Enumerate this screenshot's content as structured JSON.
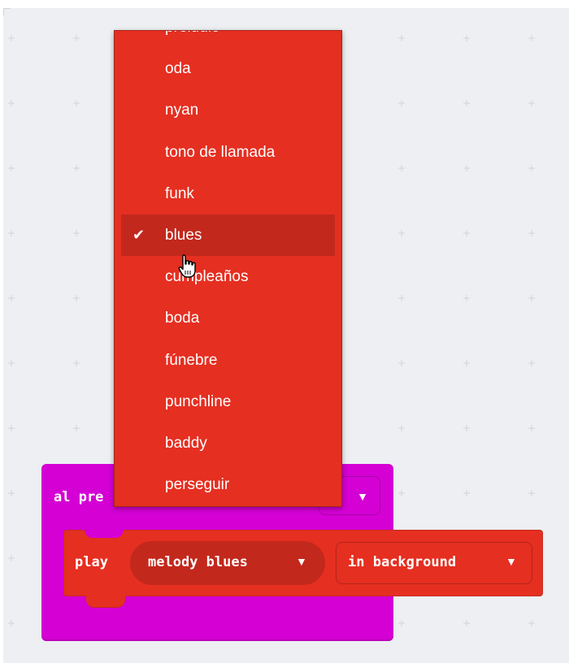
{
  "event_block": {
    "label": "al pre",
    "color": "#d400d4",
    "dropdown_arrow": "▼"
  },
  "play_block": {
    "play_label": "play",
    "melody_label": "melody blues",
    "melody_arrow": "▼",
    "background_label": "in background",
    "background_arrow": "▼",
    "color": "#e52f21"
  },
  "menu": {
    "items": [
      {
        "label": "preludio"
      },
      {
        "label": "oda"
      },
      {
        "label": "nyan"
      },
      {
        "label": "tono de llamada"
      },
      {
        "label": "funk"
      },
      {
        "label": "blues",
        "selected": true
      },
      {
        "label": "cumpleaños"
      },
      {
        "label": "boda"
      },
      {
        "label": "fúnebre"
      },
      {
        "label": "punchline"
      },
      {
        "label": "baddy"
      },
      {
        "label": "perseguir"
      }
    ],
    "check_icon": "check-icon",
    "cursor_icon": "hand-pointer-icon"
  }
}
